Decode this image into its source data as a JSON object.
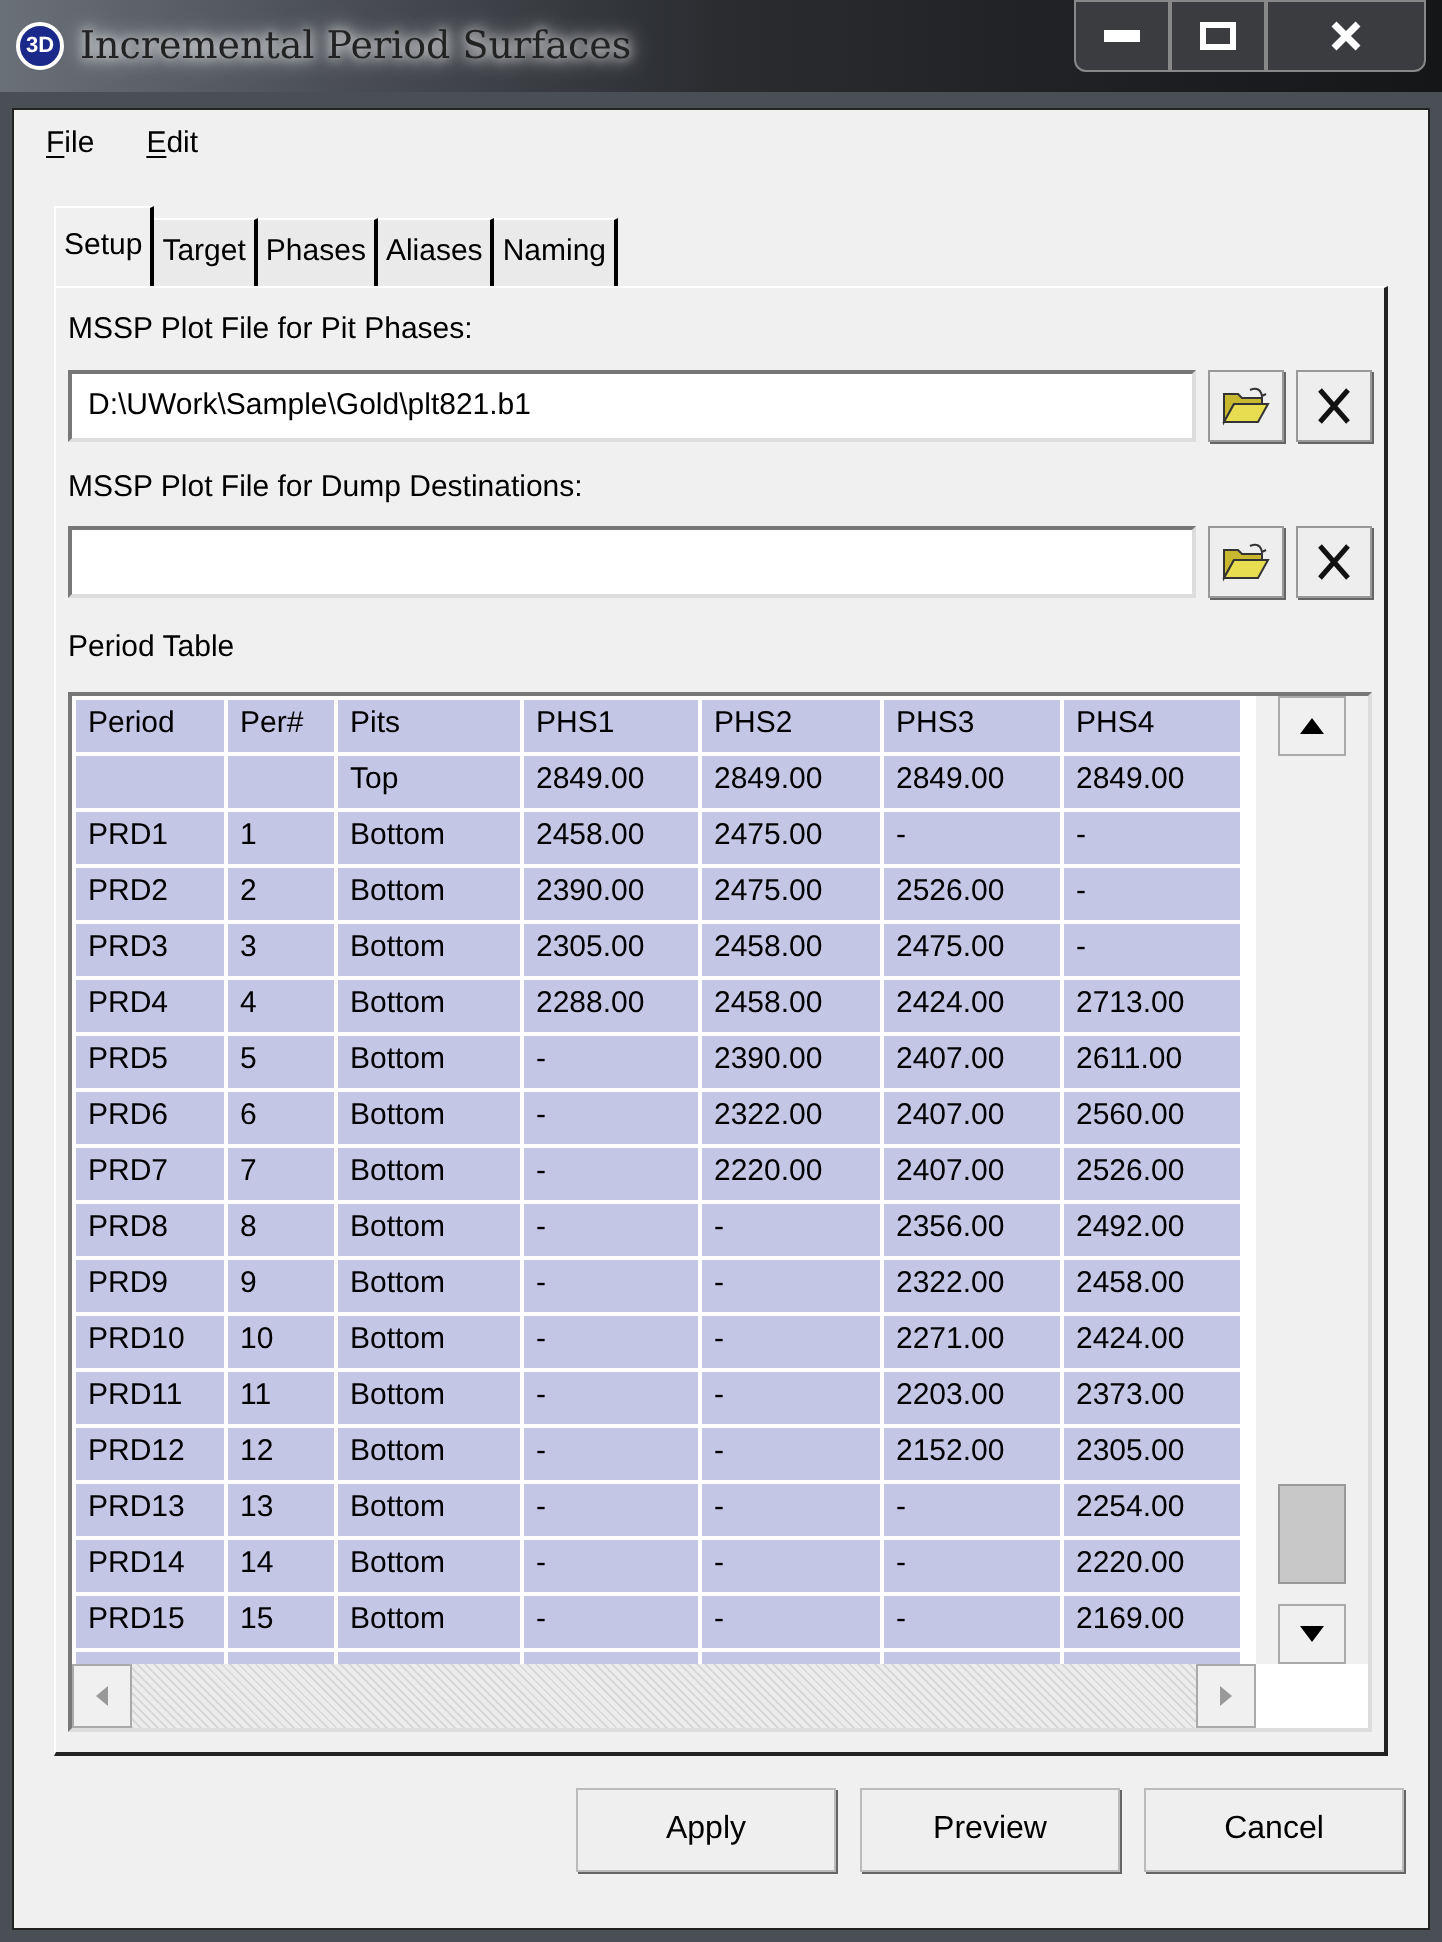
{
  "window": {
    "title": "Incremental Period Surfaces",
    "app_icon": "3D"
  },
  "menu": [
    "File",
    "Edit"
  ],
  "tabs": [
    {
      "label": "Setup",
      "selected": true
    },
    {
      "label": "Target",
      "selected": false
    },
    {
      "label": "Phases",
      "selected": false
    },
    {
      "label": "Aliases",
      "selected": false
    },
    {
      "label": "Naming",
      "selected": false
    }
  ],
  "pit_file": {
    "label": "MSSP Plot File for Pit Phases:",
    "value": "D:\\UWork\\Sample\\Gold\\plt821.b1"
  },
  "dump_file": {
    "label": "MSSP Plot File for Dump Destinations:"
  },
  "table": {
    "title": "Period Table",
    "columns": [
      "Period",
      "Per#",
      "Pits",
      "PHS1",
      "PHS2",
      "PHS3",
      "PHS4"
    ],
    "rows": [
      [
        "",
        "",
        "Top",
        "2849.00",
        "2849.00",
        "2849.00",
        "2849.00"
      ],
      [
        "PRD1",
        "1",
        "Bottom",
        "2458.00",
        "2475.00",
        "-",
        "-"
      ],
      [
        "PRD2",
        "2",
        "Bottom",
        "2390.00",
        "2475.00",
        "2526.00",
        "-"
      ],
      [
        "PRD3",
        "3",
        "Bottom",
        "2305.00",
        "2458.00",
        "2475.00",
        "-"
      ],
      [
        "PRD4",
        "4",
        "Bottom",
        "2288.00",
        "2458.00",
        "2424.00",
        "2713.00"
      ],
      [
        "PRD5",
        "5",
        "Bottom",
        "-",
        "2390.00",
        "2407.00",
        "2611.00"
      ],
      [
        "PRD6",
        "6",
        "Bottom",
        "-",
        "2322.00",
        "2407.00",
        "2560.00"
      ],
      [
        "PRD7",
        "7",
        "Bottom",
        "-",
        "2220.00",
        "2407.00",
        "2526.00"
      ],
      [
        "PRD8",
        "8",
        "Bottom",
        "-",
        "-",
        "2356.00",
        "2492.00"
      ],
      [
        "PRD9",
        "9",
        "Bottom",
        "-",
        "-",
        "2322.00",
        "2458.00"
      ],
      [
        "PRD10",
        "10",
        "Bottom",
        "-",
        "-",
        "2271.00",
        "2424.00"
      ],
      [
        "PRD11",
        "11",
        "Bottom",
        "-",
        "-",
        "2203.00",
        "2373.00"
      ],
      [
        "PRD12",
        "12",
        "Bottom",
        "-",
        "-",
        "2152.00",
        "2305.00"
      ],
      [
        "PRD13",
        "13",
        "Bottom",
        "-",
        "-",
        "-",
        "2254.00"
      ],
      [
        "PRD14",
        "14",
        "Bottom",
        "-",
        "-",
        "-",
        "2220.00"
      ],
      [
        "PRD15",
        "15",
        "Bottom",
        "-",
        "-",
        "-",
        "2169.00"
      ]
    ]
  },
  "buttons": [
    "Apply",
    "Preview",
    "Cancel"
  ]
}
